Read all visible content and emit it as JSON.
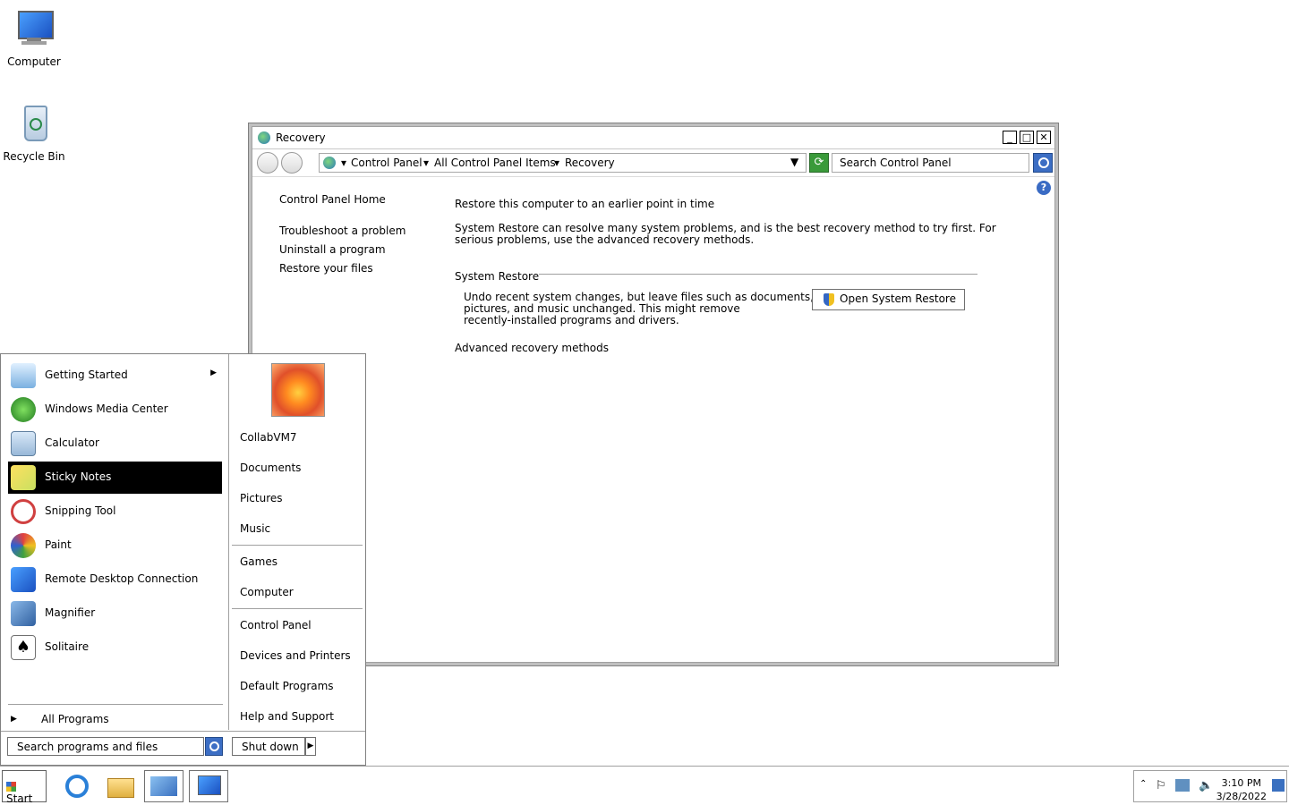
{
  "desktop": {
    "icons": [
      {
        "label": "Computer"
      },
      {
        "label": "Recycle Bin"
      }
    ]
  },
  "window": {
    "title": "Recovery",
    "controls": {
      "minimize": "_",
      "maximize": "□",
      "close": "✕"
    },
    "address": {
      "crumbs": [
        "Control Panel",
        "All Control Panel Items",
        "Recovery"
      ]
    },
    "search_placeholder": "Search Control Panel",
    "left_nav": {
      "home": "Control Panel Home",
      "links": [
        "Troubleshoot a problem",
        "Uninstall a program",
        "Restore your files"
      ]
    },
    "content": {
      "heading": "Restore this computer to an earlier point in time",
      "intro_line1": "System Restore can resolve many system problems, and is the best recovery method to try first. For",
      "intro_line2": "serious problems, use the advanced recovery methods.",
      "section_title": "System Restore",
      "section_text1": "Undo recent system changes, but leave files such as documents,",
      "section_text2": "pictures, and music unchanged. This might remove",
      "section_text3": "recently-installed programs and drivers.",
      "button_label": "Open System Restore",
      "advanced_link": "Advanced recovery methods"
    }
  },
  "start_menu": {
    "programs": [
      {
        "label": "Getting Started",
        "has_submenu": true
      },
      {
        "label": "Windows Media Center"
      },
      {
        "label": "Calculator"
      },
      {
        "label": "Sticky Notes",
        "selected": true
      },
      {
        "label": "Snipping Tool"
      },
      {
        "label": "Paint"
      },
      {
        "label": "Remote Desktop Connection"
      },
      {
        "label": "Magnifier"
      },
      {
        "label": "Solitaire"
      }
    ],
    "all_programs": "All Programs",
    "search_placeholder": "Search programs and files",
    "right_items": {
      "user": "CollabVM7",
      "documents": "Documents",
      "pictures": "Pictures",
      "music": "Music",
      "games": "Games",
      "computer": "Computer",
      "control_panel": "Control Panel",
      "devices": "Devices and Printers",
      "default_programs": "Default Programs",
      "help": "Help and Support"
    },
    "shutdown_label": "Shut down"
  },
  "taskbar": {
    "start_label": "Start",
    "clock_time": "3:10 PM",
    "clock_date": "3/28/2022"
  }
}
